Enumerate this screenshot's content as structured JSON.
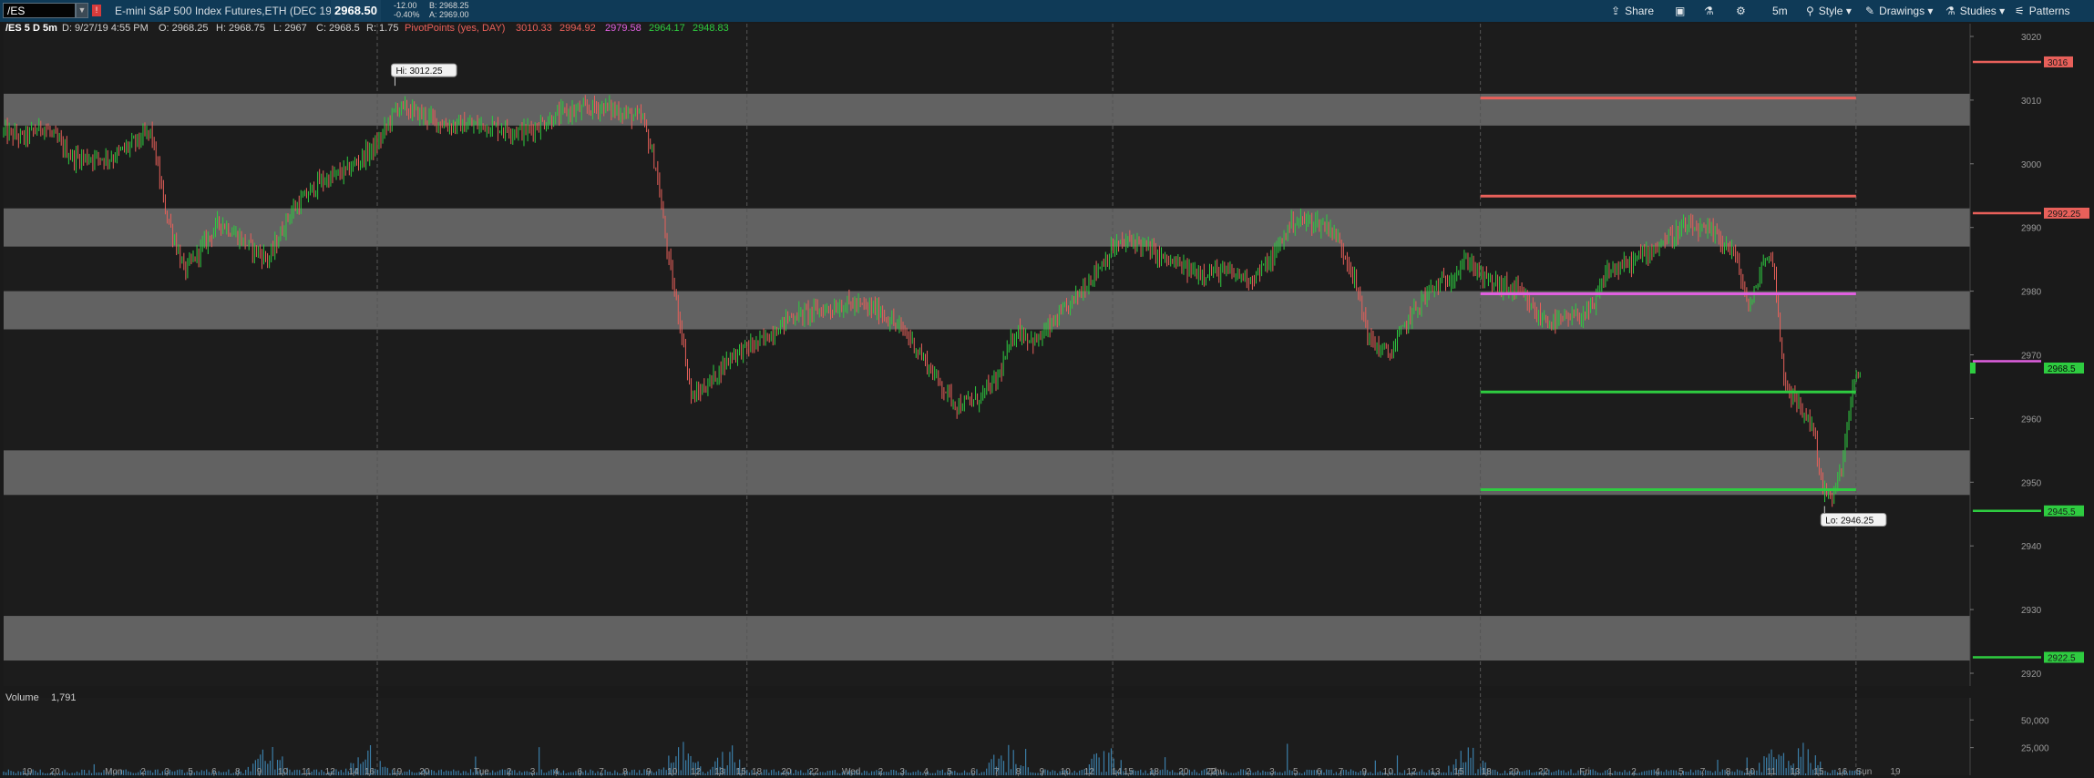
{
  "toolbar": {
    "symbol": "/ES",
    "description": "E-mini S&P 500 Index Futures,ETH (DEC 19)",
    "last_price": "2968.50",
    "net_change": "-12.00",
    "pct_change": "-0.40%",
    "bid": "B: 2968.25",
    "ask": "A: 2969.00",
    "buttons": [
      {
        "label": "Share",
        "icon": "share-icon"
      },
      {
        "label": "",
        "icon": "save-icon"
      },
      {
        "label": "",
        "icon": "flask-icon"
      },
      {
        "label": "",
        "icon": "gear-icon"
      },
      {
        "label": "5m",
        "icon": ""
      },
      {
        "label": "Style",
        "icon": "style-icon"
      },
      {
        "label": "Drawings",
        "icon": "pencil-icon"
      },
      {
        "label": "Studies",
        "icon": "flask-icon"
      },
      {
        "label": "Patterns",
        "icon": "patterns-icon"
      }
    ]
  },
  "info_bar": {
    "title": "/ES 5 D 5m",
    "date": "D: 9/27/19 4:55 PM",
    "open": "O: 2968.25",
    "high": "H: 2968.75",
    "low": "L: 2967",
    "close": "C: 2968.5",
    "range": "R: 1.75",
    "study_name": "PivotPoints (yes, DAY)",
    "pivot_values": [
      {
        "text": "3010.33",
        "color": "#e8605a"
      },
      {
        "text": "2994.92",
        "color": "#e8605a"
      },
      {
        "text": "2979.58",
        "color": "#e060e0"
      },
      {
        "text": "2964.17",
        "color": "#2ecc40"
      },
      {
        "text": "2948.83",
        "color": "#2ecc40"
      }
    ]
  },
  "colors": {
    "background": "#1a1a1a",
    "zone": "#6a6a6a",
    "up_candle": "#2ecc40",
    "down_candle": "#e8605a",
    "resistance": "#e8605a",
    "pivot": "#e060e0",
    "support": "#2ecc40",
    "volume_bar": "#3b7ea8"
  },
  "chart_data": {
    "type": "candlestick",
    "symbol": "/ES",
    "interval": "5m",
    "y_range": [
      2918,
      3022
    ],
    "y_ticks": [
      3020,
      3010,
      3000,
      2990,
      2980,
      2970,
      2960,
      2950,
      2940,
      2930,
      2920
    ],
    "gray_zones": [
      [
        3006,
        3011
      ],
      [
        2987,
        2993
      ],
      [
        2974,
        2980
      ],
      [
        2948,
        2955
      ],
      [
        2922,
        2929
      ]
    ],
    "price_path": [
      [
        0.0,
        3005
      ],
      [
        0.01,
        3004
      ],
      [
        0.02,
        3006
      ],
      [
        0.035,
        3001
      ],
      [
        0.055,
        3001
      ],
      [
        0.075,
        3005
      ],
      [
        0.082,
        2993
      ],
      [
        0.092,
        2983
      ],
      [
        0.11,
        2991
      ],
      [
        0.125,
        2987
      ],
      [
        0.135,
        2985
      ],
      [
        0.145,
        2992
      ],
      [
        0.16,
        2997
      ],
      [
        0.175,
        2999
      ],
      [
        0.19,
        3003
      ],
      [
        0.2,
        3009
      ],
      [
        0.21,
        3008
      ],
      [
        0.225,
        3006
      ],
      [
        0.245,
        3006
      ],
      [
        0.265,
        3005
      ],
      [
        0.285,
        3008
      ],
      [
        0.305,
        3009
      ],
      [
        0.325,
        3007
      ],
      [
        0.332,
        2999
      ],
      [
        0.338,
        2985
      ],
      [
        0.344,
        2975
      ],
      [
        0.35,
        2963
      ],
      [
        0.36,
        2966
      ],
      [
        0.37,
        2970
      ],
      [
        0.385,
        2972
      ],
      [
        0.4,
        2976
      ],
      [
        0.415,
        2977
      ],
      [
        0.43,
        2978
      ],
      [
        0.445,
        2977
      ],
      [
        0.46,
        2973
      ],
      [
        0.475,
        2966
      ],
      [
        0.485,
        2962
      ],
      [
        0.495,
        2963
      ],
      [
        0.505,
        2966
      ],
      [
        0.515,
        2974
      ],
      [
        0.525,
        2972
      ],
      [
        0.54,
        2977
      ],
      [
        0.555,
        2983
      ],
      [
        0.565,
        2987
      ],
      [
        0.575,
        2988
      ],
      [
        0.59,
        2985
      ],
      [
        0.605,
        2983
      ],
      [
        0.62,
        2983
      ],
      [
        0.635,
        2982
      ],
      [
        0.645,
        2985
      ],
      [
        0.655,
        2991
      ],
      [
        0.665,
        2991
      ],
      [
        0.675,
        2990
      ],
      [
        0.685,
        2984
      ],
      [
        0.695,
        2972
      ],
      [
        0.705,
        2970
      ],
      [
        0.715,
        2976
      ],
      [
        0.725,
        2980
      ],
      [
        0.735,
        2982
      ],
      [
        0.745,
        2985
      ],
      [
        0.752,
        2982
      ],
      [
        0.76,
        2981
      ],
      [
        0.77,
        2980
      ],
      [
        0.78,
        2976
      ],
      [
        0.79,
        2975
      ],
      [
        0.8,
        2976
      ],
      [
        0.808,
        2977
      ],
      [
        0.815,
        2983
      ],
      [
        0.825,
        2984
      ],
      [
        0.835,
        2986
      ],
      [
        0.845,
        2988
      ],
      [
        0.855,
        2990
      ],
      [
        0.87,
        2989
      ],
      [
        0.88,
        2986
      ],
      [
        0.888,
        2977
      ],
      [
        0.895,
        2985
      ],
      [
        0.9,
        2985
      ],
      [
        0.905,
        2967
      ],
      [
        0.91,
        2963
      ],
      [
        0.92,
        2959
      ],
      [
        0.925,
        2949
      ],
      [
        0.93,
        2947
      ],
      [
        0.935,
        2953
      ],
      [
        0.94,
        2964
      ],
      [
        0.945,
        2968.5
      ]
    ],
    "high": {
      "label": "Hi: 3012.25",
      "value": 3012.25,
      "x_frac": 0.199
    },
    "low": {
      "label": "Lo: 2946.25",
      "value": 2946.25,
      "x_frac": 0.926
    },
    "levels": [
      {
        "value": 3010.33,
        "color": "#e8605a",
        "start_frac": 0.751,
        "end_frac": 0.942
      },
      {
        "value": 2994.92,
        "color": "#e8605a",
        "start_frac": 0.751,
        "end_frac": 0.942
      },
      {
        "value": 2979.58,
        "color": "#e060e0",
        "start_frac": 0.751,
        "end_frac": 0.942
      },
      {
        "value": 2964.17,
        "color": "#2ecc40",
        "start_frac": 0.751,
        "end_frac": 0.942
      },
      {
        "value": 2948.83,
        "color": "#2ecc40",
        "start_frac": 0.751,
        "end_frac": 0.942
      }
    ],
    "right_markers": [
      {
        "value": 3016,
        "label": "3016",
        "color": "#e8605a"
      },
      {
        "value": 2992.25,
        "label": "2992.25",
        "color": "#e8605a"
      },
      {
        "value": 2969,
        "label": "",
        "color": "#e060e0"
      },
      {
        "value": 2945.5,
        "label": "2945.5",
        "color": "#2ecc40"
      },
      {
        "value": 2922.5,
        "label": "2922.5",
        "color": "#2ecc40"
      }
    ],
    "current_price": {
      "value": 2968.5,
      "label": "2968.5",
      "color": "#2ecc40"
    },
    "day_separators": [
      0.19,
      0.378,
      0.564,
      0.751,
      0.942
    ],
    "x_ticks": [
      [
        "19",
        0.012
      ],
      [
        "20",
        0.026
      ],
      [
        "Mon",
        0.056
      ],
      [
        "2",
        0.071
      ],
      [
        "3",
        0.083
      ],
      [
        "5",
        0.095
      ],
      [
        "6",
        0.107
      ],
      [
        "8",
        0.119
      ],
      [
        "9",
        0.13
      ],
      [
        "10",
        0.142
      ],
      [
        "11",
        0.154
      ],
      [
        "12",
        0.166
      ],
      [
        "14",
        0.178
      ],
      [
        "16",
        0.186
      ],
      [
        "19",
        0.2
      ],
      [
        "20",
        0.214
      ],
      [
        "Tue",
        0.243
      ],
      [
        "2",
        0.257
      ],
      [
        "3",
        0.269
      ],
      [
        "4",
        0.281
      ],
      [
        "6",
        0.293
      ],
      [
        "7",
        0.304
      ],
      [
        "8",
        0.316
      ],
      [
        "9",
        0.328
      ],
      [
        "10",
        0.34
      ],
      [
        "12",
        0.352
      ],
      [
        "13",
        0.364
      ],
      [
        "15",
        0.375
      ],
      [
        "18",
        0.383
      ],
      [
        "20",
        0.398
      ],
      [
        "22",
        0.412
      ],
      [
        "Wed",
        0.431
      ],
      [
        "2",
        0.446
      ],
      [
        "3",
        0.457
      ],
      [
        "4",
        0.469
      ],
      [
        "5",
        0.481
      ],
      [
        "6",
        0.493
      ],
      [
        "7",
        0.505
      ],
      [
        "8",
        0.516
      ],
      [
        "9",
        0.528
      ],
      [
        "10",
        0.54
      ],
      [
        "12",
        0.552
      ],
      [
        "14",
        0.566
      ],
      [
        "15",
        0.572
      ],
      [
        "18",
        0.585
      ],
      [
        "20",
        0.6
      ],
      [
        "22",
        0.614
      ],
      [
        "Thu",
        0.617
      ],
      [
        "2",
        0.633
      ],
      [
        "3",
        0.645
      ],
      [
        "5",
        0.657
      ],
      [
        "6",
        0.669
      ],
      [
        "7",
        0.68
      ],
      [
        "9",
        0.692
      ],
      [
        "10",
        0.704
      ],
      [
        "12",
        0.716
      ],
      [
        "13",
        0.728
      ],
      [
        "15",
        0.74
      ],
      [
        "18",
        0.754
      ],
      [
        "20",
        0.768
      ],
      [
        "22",
        0.783
      ],
      [
        "Fri",
        0.804
      ],
      [
        "1",
        0.817
      ],
      [
        "2",
        0.829
      ],
      [
        "4",
        0.841
      ],
      [
        "5",
        0.853
      ],
      [
        "7",
        0.864
      ],
      [
        "8",
        0.877
      ],
      [
        "10",
        0.888
      ],
      [
        "11",
        0.899
      ],
      [
        "13",
        0.911
      ],
      [
        "15",
        0.923
      ],
      [
        "16",
        0.935
      ],
      [
        "Sun",
        0.946
      ],
      [
        "19",
        0.962
      ]
    ],
    "volume": {
      "label": "Volume",
      "value": "1,791",
      "y_ticks": [
        [
          "50,000",
          50000
        ],
        [
          "25,000",
          25000
        ]
      ],
      "max": 70000
    }
  }
}
